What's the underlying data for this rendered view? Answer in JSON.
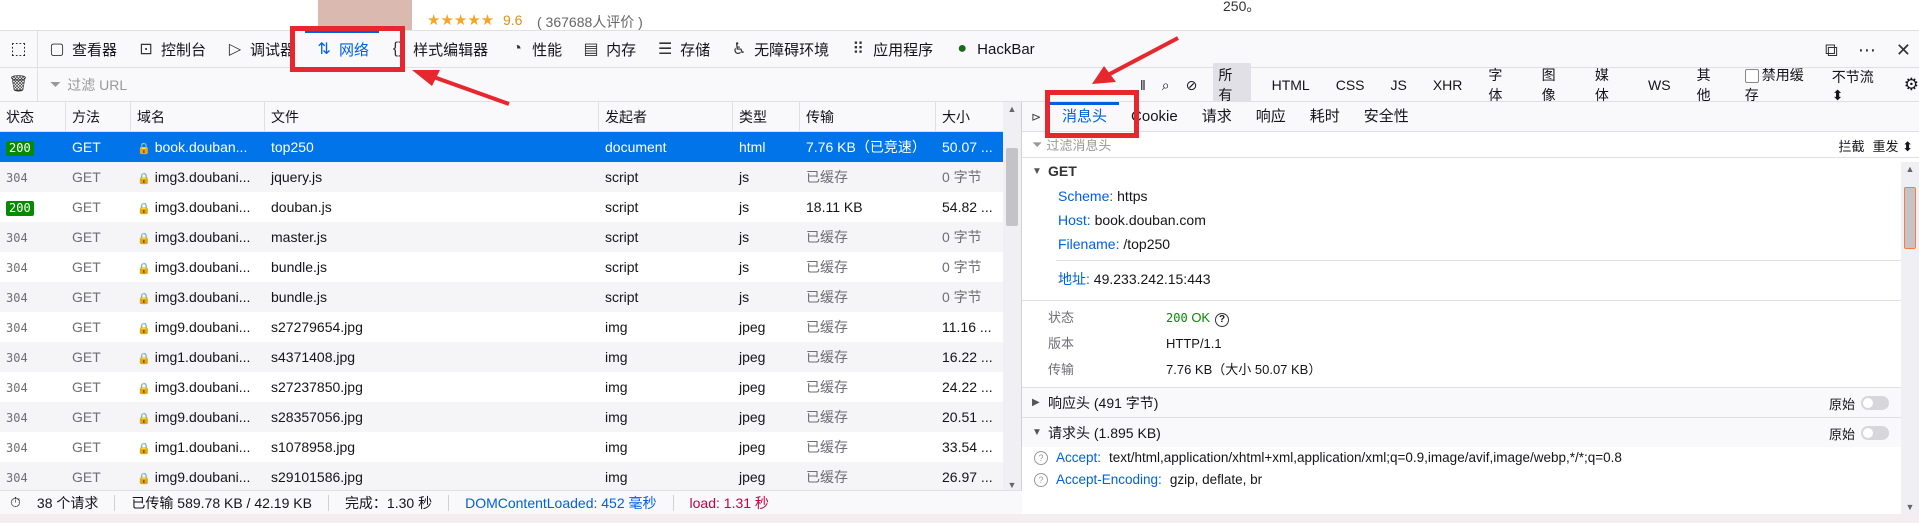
{
  "page_strip": {
    "stars": "★★★★★",
    "rating": "9.6",
    "rating_count": "( 367688人评价 )",
    "tail_text": "250。"
  },
  "toolbox": {
    "tabs": [
      {
        "label": "查看器",
        "icon": "inspector-icon"
      },
      {
        "label": "控制台",
        "icon": "console-icon"
      },
      {
        "label": "调试器",
        "icon": "debugger-icon"
      },
      {
        "label": "网络",
        "icon": "network-arrows-icon",
        "selected": true
      },
      {
        "label": "样式编辑器",
        "icon": "braces-icon"
      },
      {
        "label": "性能",
        "icon": "gauge-icon"
      },
      {
        "label": "内存",
        "icon": "memory-chip-icon"
      },
      {
        "label": "存储",
        "icon": "storage-icon"
      },
      {
        "label": "无障碍环境",
        "icon": "accessibility-icon"
      },
      {
        "label": "应用程序",
        "icon": "grid-apps-icon"
      },
      {
        "label": "HackBar",
        "icon": "hackbar-logo-icon"
      }
    ]
  },
  "filter_bar": {
    "url_placeholder": "过滤 URL",
    "types": [
      "所有",
      "HTML",
      "CSS",
      "JS",
      "XHR",
      "字体",
      "图像",
      "媒体",
      "WS",
      "其他"
    ],
    "active_type": "所有",
    "disable_cache": "禁用缓存",
    "throttle": "不节流 ⬍"
  },
  "table": {
    "columns": [
      "状态",
      "方法",
      "域名",
      "文件",
      "发起者",
      "类型",
      "传输",
      "大小"
    ],
    "rows": [
      {
        "status": "200",
        "method": "GET",
        "domain": "book.douban...",
        "file": "top250",
        "initiator": "document",
        "type": "html",
        "transferred": "7.76 KB（已竞速）",
        "size": "50.07 ..."
      },
      {
        "status": "304",
        "method": "GET",
        "domain": "img3.doubani...",
        "file": "jquery.js",
        "initiator": "script",
        "type": "js",
        "transferred": "已缓存",
        "size": "0 字节"
      },
      {
        "status": "200",
        "method": "GET",
        "domain": "img3.doubani...",
        "file": "douban.js",
        "initiator": "script",
        "type": "js",
        "transferred": "18.11 KB",
        "size": "54.82 ..."
      },
      {
        "status": "304",
        "method": "GET",
        "domain": "img3.doubani...",
        "file": "master.js",
        "initiator": "script",
        "type": "js",
        "transferred": "已缓存",
        "size": "0 字节"
      },
      {
        "status": "304",
        "method": "GET",
        "domain": "img3.doubani...",
        "file": "bundle.js",
        "initiator": "script",
        "type": "js",
        "transferred": "已缓存",
        "size": "0 字节"
      },
      {
        "status": "304",
        "method": "GET",
        "domain": "img3.doubani...",
        "file": "bundle.js",
        "initiator": "script",
        "type": "js",
        "transferred": "已缓存",
        "size": "0 字节"
      },
      {
        "status": "304",
        "method": "GET",
        "domain": "img9.doubani...",
        "file": "s27279654.jpg",
        "initiator": "img",
        "type": "jpeg",
        "transferred": "已缓存",
        "size": "11.16 ..."
      },
      {
        "status": "304",
        "method": "GET",
        "domain": "img1.doubani...",
        "file": "s4371408.jpg",
        "initiator": "img",
        "type": "jpeg",
        "transferred": "已缓存",
        "size": "16.22 ..."
      },
      {
        "status": "304",
        "method": "GET",
        "domain": "img3.doubani...",
        "file": "s27237850.jpg",
        "initiator": "img",
        "type": "jpeg",
        "transferred": "已缓存",
        "size": "24.22 ..."
      },
      {
        "status": "304",
        "method": "GET",
        "domain": "img9.doubani...",
        "file": "s28357056.jpg",
        "initiator": "img",
        "type": "jpeg",
        "transferred": "已缓存",
        "size": "20.51 ..."
      },
      {
        "status": "304",
        "method": "GET",
        "domain": "img1.doubani...",
        "file": "s1078958.jpg",
        "initiator": "img",
        "type": "jpeg",
        "transferred": "已缓存",
        "size": "33.54 ..."
      },
      {
        "status": "304",
        "method": "GET",
        "domain": "img9.doubani...",
        "file": "s29101586.jpg",
        "initiator": "img",
        "type": "jpeg",
        "transferred": "已缓存",
        "size": "26.97 ..."
      }
    ]
  },
  "status_bar": {
    "requests": "38 个请求",
    "transferred": "已传输 589.78 KB / 42.19 KB",
    "finish": "完成：1.30 秒",
    "dom_content_loaded": "DOMContentLoaded: 452 毫秒",
    "load": "load: 1.31 秒"
  },
  "details": {
    "tabs": [
      "消息头",
      "Cookie",
      "请求",
      "响应",
      "耗时",
      "安全性"
    ],
    "selected_tab": "消息头",
    "filter_placeholder": "过滤消息头",
    "block": "拦截",
    "resend": "重发 ⬍",
    "get_section": {
      "title": "GET",
      "scheme_key": "Scheme:",
      "scheme_val": "https",
      "host_key": "Host:",
      "host_val": "book.douban.com",
      "filename_key": "Filename:",
      "filename_val": "/top250",
      "address_key": "地址:",
      "address_val": "49.233.242.15:443"
    },
    "status_label": "状态",
    "status_code": "200",
    "status_text": "OK",
    "version_label": "版本",
    "version_val": "HTTP/1.1",
    "transfer_label": "传输",
    "transfer_val": "7.76 KB（大小 50.07 KB）",
    "response_headers": "响应头 (491 字节)",
    "request_headers": "请求头 (1.895 KB)",
    "raw_label": "原始",
    "request_header_rows": [
      {
        "key": "Accept:",
        "value": "text/html,application/xhtml+xml,application/xml;q=0.9,image/avif,image/webp,*/*;q=0.8"
      },
      {
        "key": "Accept-Encoding:",
        "value": "gzip, deflate, br"
      }
    ]
  },
  "colors": {
    "accent": "#0061e0",
    "selected_row": "#0074e8",
    "status_ok": "#058b00",
    "annotation": "#e8262d"
  }
}
